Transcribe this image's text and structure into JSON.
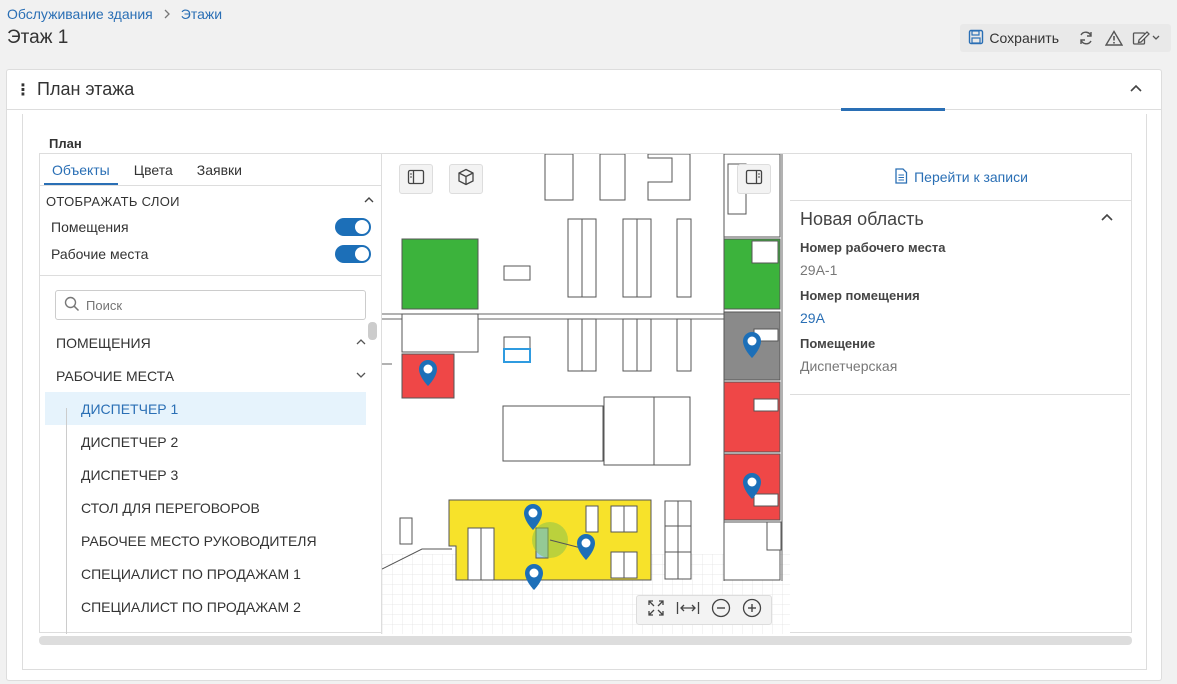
{
  "breadcrumb": {
    "parent": "Обслуживание здания",
    "current": "Этажи"
  },
  "page_title": "Этаж 1",
  "toolbar": {
    "save_label": "Сохранить"
  },
  "panel": {
    "title": "План этажа"
  },
  "plan": {
    "label": "План",
    "tabs": [
      "Объекты",
      "Цвета",
      "Заявки"
    ],
    "layers": {
      "heading": "ОТОБРАЖАТЬ СЛОИ",
      "items": [
        {
          "label": "Помещения",
          "enabled": true
        },
        {
          "label": "Рабочие места",
          "enabled": true
        }
      ]
    },
    "search": {
      "placeholder": "Поиск"
    },
    "groups": {
      "rooms": "ПОМЕЩЕНИЯ",
      "workplaces": "РАБОЧИЕ МЕСТА"
    },
    "workplaces": [
      "ДИСПЕТЧЕР 1",
      "ДИСПЕТЧЕР 2",
      "ДИСПЕТЧЕР 3",
      "СТОЛ ДЛЯ ПЕРЕГОВОРОВ",
      "РАБОЧЕЕ МЕСТО РУКОВОДИТЕЛЯ",
      "СПЕЦИАЛИСТ ПО ПРОДАЖАМ 1",
      "СПЕЦИАЛИСТ ПО ПРОДАЖАМ 2"
    ]
  },
  "details": {
    "goto_label": "Перейти к записи",
    "area_title": "Новая область",
    "fields": [
      {
        "label": "Номер рабочего места",
        "value": "29А-1"
      },
      {
        "label": "Номер помещения",
        "value": "29А"
      },
      {
        "label": "Помещение",
        "value": "Диспетчерская"
      }
    ]
  },
  "colors": {
    "accent": "#2a6fb5",
    "room_green": "#3cb33c",
    "room_red": "#ef4747",
    "room_gray": "#8a8a8a",
    "room_yellow": "#f7e22a"
  }
}
